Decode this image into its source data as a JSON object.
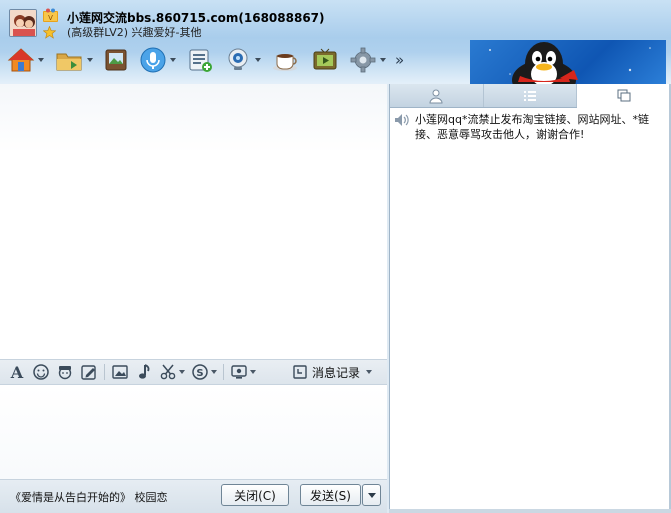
{
  "window": {
    "title": "小莲网交流bbs.860715.com(168088867)",
    "subtitle": "(高级群LV2) 兴趣爱好-其他"
  },
  "toolbar": {
    "items": [
      {
        "icon": "home-icon",
        "has_dropdown": true
      },
      {
        "icon": "folder-icon",
        "has_dropdown": true
      },
      {
        "icon": "album-icon",
        "has_dropdown": false
      },
      {
        "icon": "voice-icon",
        "has_dropdown": true
      },
      {
        "icon": "list-add-icon",
        "has_dropdown": false
      },
      {
        "icon": "webcam-icon",
        "has_dropdown": true
      },
      {
        "icon": "coffee-icon",
        "has_dropdown": false
      },
      {
        "icon": "tv-icon",
        "has_dropdown": false
      },
      {
        "icon": "gear-icon",
        "has_dropdown": true
      }
    ],
    "more_label": "»"
  },
  "format_bar": {
    "icons": [
      "font-icon",
      "smiley-icon",
      "sticker-icon",
      "edit-icon",
      "image-icon",
      "music-icon",
      "scissors-icon",
      "s-icon",
      "screen-icon"
    ],
    "message_log_label": "消息记录"
  },
  "bottom": {
    "song": "《爱情是从告白开始的》 校园恋",
    "close_label": "关闭(C)",
    "send_label": "发送(S)"
  },
  "right_panel": {
    "tabs": [
      "members-icon",
      "list-icon",
      "windows-icon"
    ],
    "active_tab": 2,
    "notice": "小莲网qq*流禁止发布淘宝链接、网站网址、*链接、恶意辱骂攻击他人，谢谢合作!"
  },
  "colors": {
    "header": "#a9cdec",
    "banner": "#1a63c0",
    "panel_border": "#9fb4c7"
  }
}
